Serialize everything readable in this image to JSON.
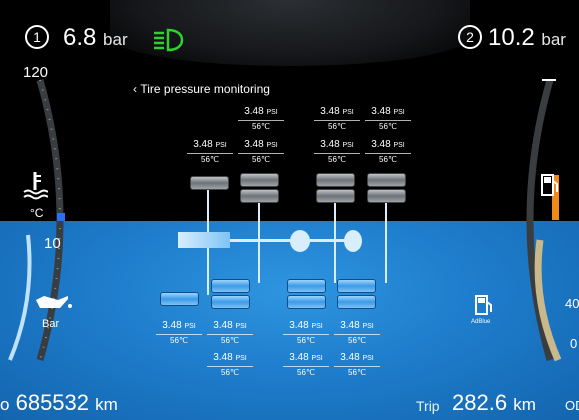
{
  "header": {
    "left_circuit": "1",
    "left_pressure_value": "6.8",
    "left_pressure_unit": "bar",
    "right_circuit": "2",
    "right_pressure_value": "10.2",
    "right_pressure_unit": "bar"
  },
  "left_gauge": {
    "top_value": "120",
    "bottom_value": "10",
    "temp_unit": "°C",
    "oil_unit": "Bar"
  },
  "right_gauge": {
    "adblue_label": "AdBlue",
    "partial_40": "40",
    "partial_0": "0"
  },
  "tpms": {
    "back_label": "Tire pressure monitoring",
    "upper_labels": [
      {
        "pressure": "3.48",
        "unit": "PSI",
        "temp": "56℃"
      },
      {
        "pressure": "3.48",
        "unit": "PSI",
        "temp": "56℃"
      },
      {
        "pressure": "3.48",
        "unit": "PSI",
        "temp": "56℃"
      },
      {
        "pressure": "3.48",
        "unit": "PSI",
        "temp": "56℃"
      },
      {
        "pressure": "3.48",
        "unit": "PSI",
        "temp": "56℃"
      },
      {
        "pressure": "3.48",
        "unit": "PSI",
        "temp": "56℃"
      },
      {
        "pressure": "3.48",
        "unit": "PSI",
        "temp": "56℃"
      }
    ],
    "lower_labels": [
      {
        "pressure": "3.48",
        "unit": "PSI",
        "temp": "56℃"
      },
      {
        "pressure": "3.48",
        "unit": "PSI",
        "temp": "56℃"
      },
      {
        "pressure": "3.48",
        "unit": "PSI",
        "temp": "56℃"
      },
      {
        "pressure": "3.48",
        "unit": "PSI",
        "temp": "56℃"
      },
      {
        "pressure": "3.48",
        "unit": "PSI",
        "temp": "56℃"
      },
      {
        "pressure": "3.48",
        "unit": "PSI",
        "temp": "56℃"
      },
      {
        "pressure": "3.48",
        "unit": "PSI",
        "temp": "56℃"
      }
    ]
  },
  "footer": {
    "odometer_value": "685532",
    "odometer_unit": "km",
    "odometer_prefix": "o",
    "trip_label": "Trip",
    "trip_value": "282.6",
    "trip_unit": "km",
    "right_edge_text": "OD"
  },
  "colors": {
    "headlight": "#2fd02f",
    "fuel_bar": "#f08a1a",
    "temp_bar": "#2e6cf0"
  }
}
